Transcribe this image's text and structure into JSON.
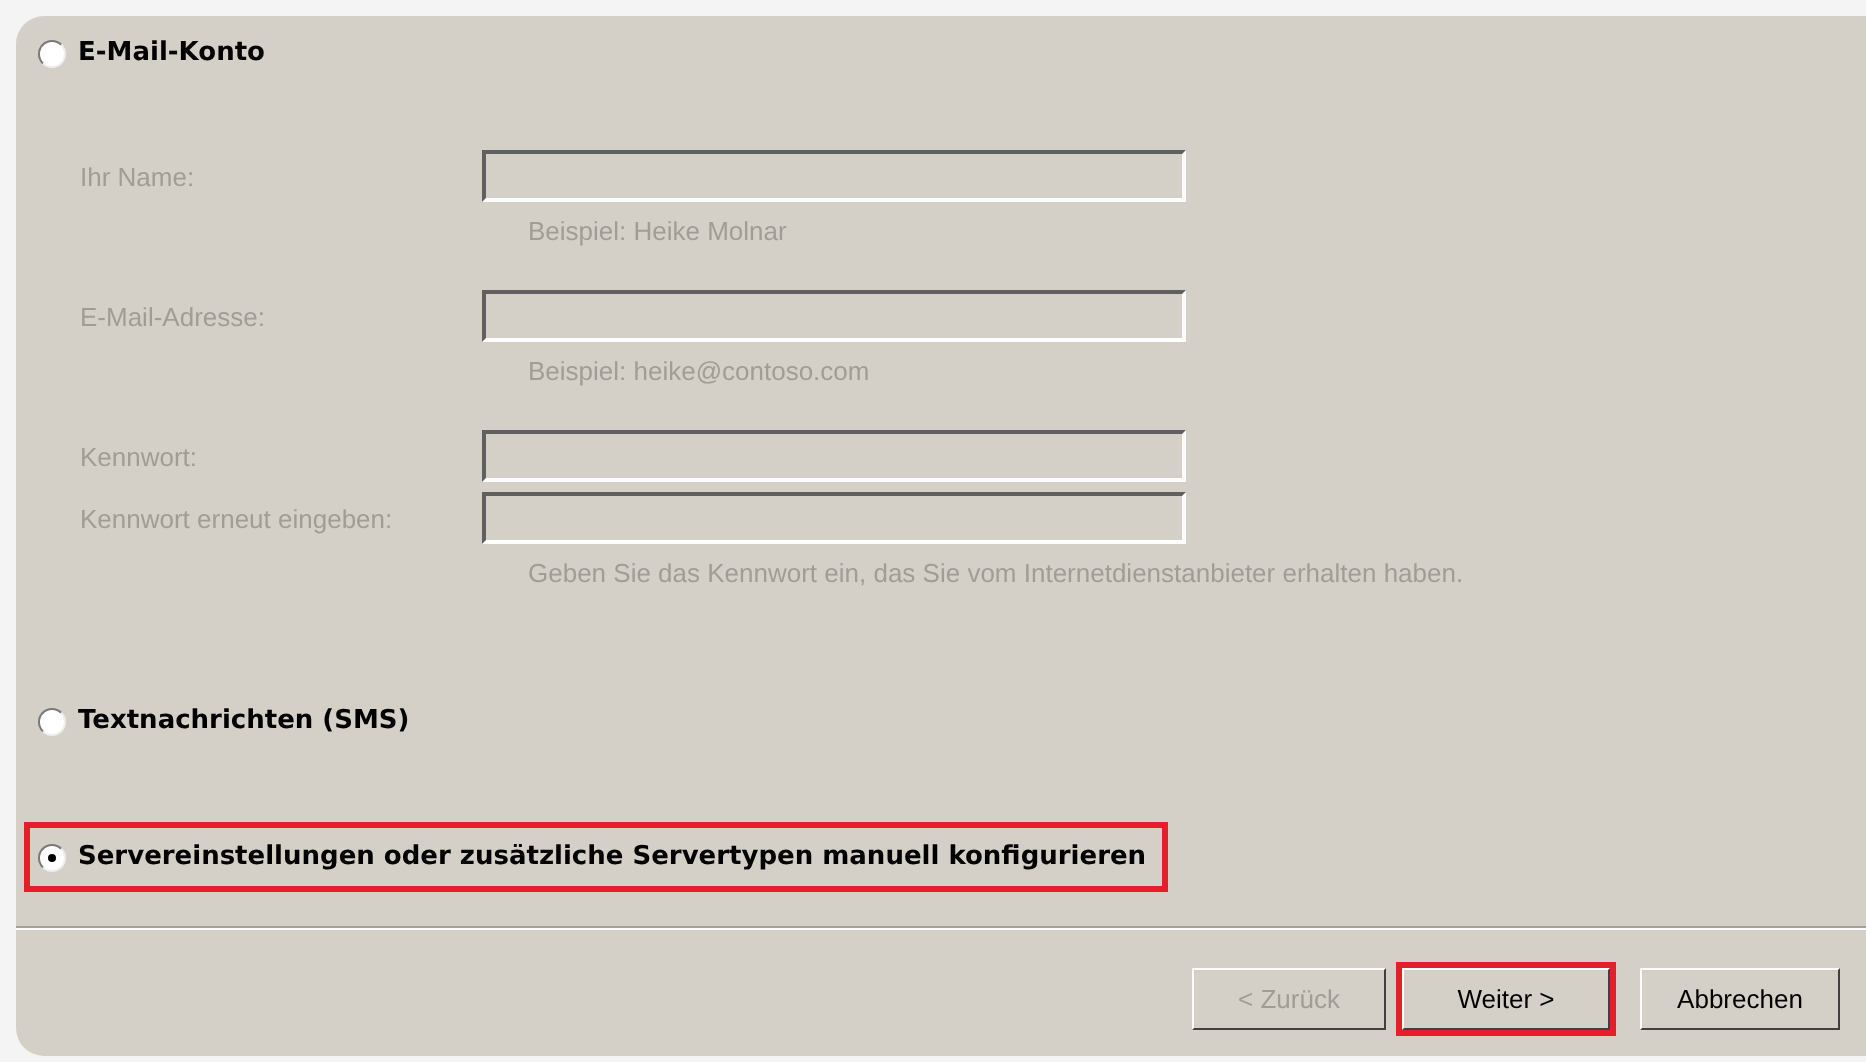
{
  "options": [
    {
      "label": "E-Mail-Konto",
      "selected": false,
      "highlighted": false,
      "kind": "form",
      "fields": [
        {
          "label": "Ihr Name:",
          "disabled": true,
          "hint": "Beispiel: Heike Molnar"
        },
        {
          "label": "E-Mail-Adresse:",
          "disabled": true,
          "hint": "Beispiel: heike@contoso.com"
        },
        {
          "label": "Kennwort:",
          "disabled": true
        },
        {
          "label": "Kennwort erneut eingeben:",
          "disabled": true,
          "hint": "Geben Sie das Kennwort ein, das Sie vom Internetdienstanbieter erhalten haben."
        }
      ]
    },
    {
      "label": "Textnachrichten (SMS)",
      "selected": false,
      "highlighted": false,
      "kind": "plain"
    },
    {
      "label": "Servereinstellungen oder zusätzliche Servertypen manuell konfigurieren",
      "selected": true,
      "highlighted": true,
      "kind": "plain"
    }
  ],
  "buttons": [
    {
      "label": "< Zurück",
      "disabled": true,
      "highlighted": false
    },
    {
      "label": "Weiter >",
      "disabled": false,
      "highlighted": true
    },
    {
      "label": "Abbrechen",
      "disabled": false,
      "highlighted": false
    }
  ]
}
